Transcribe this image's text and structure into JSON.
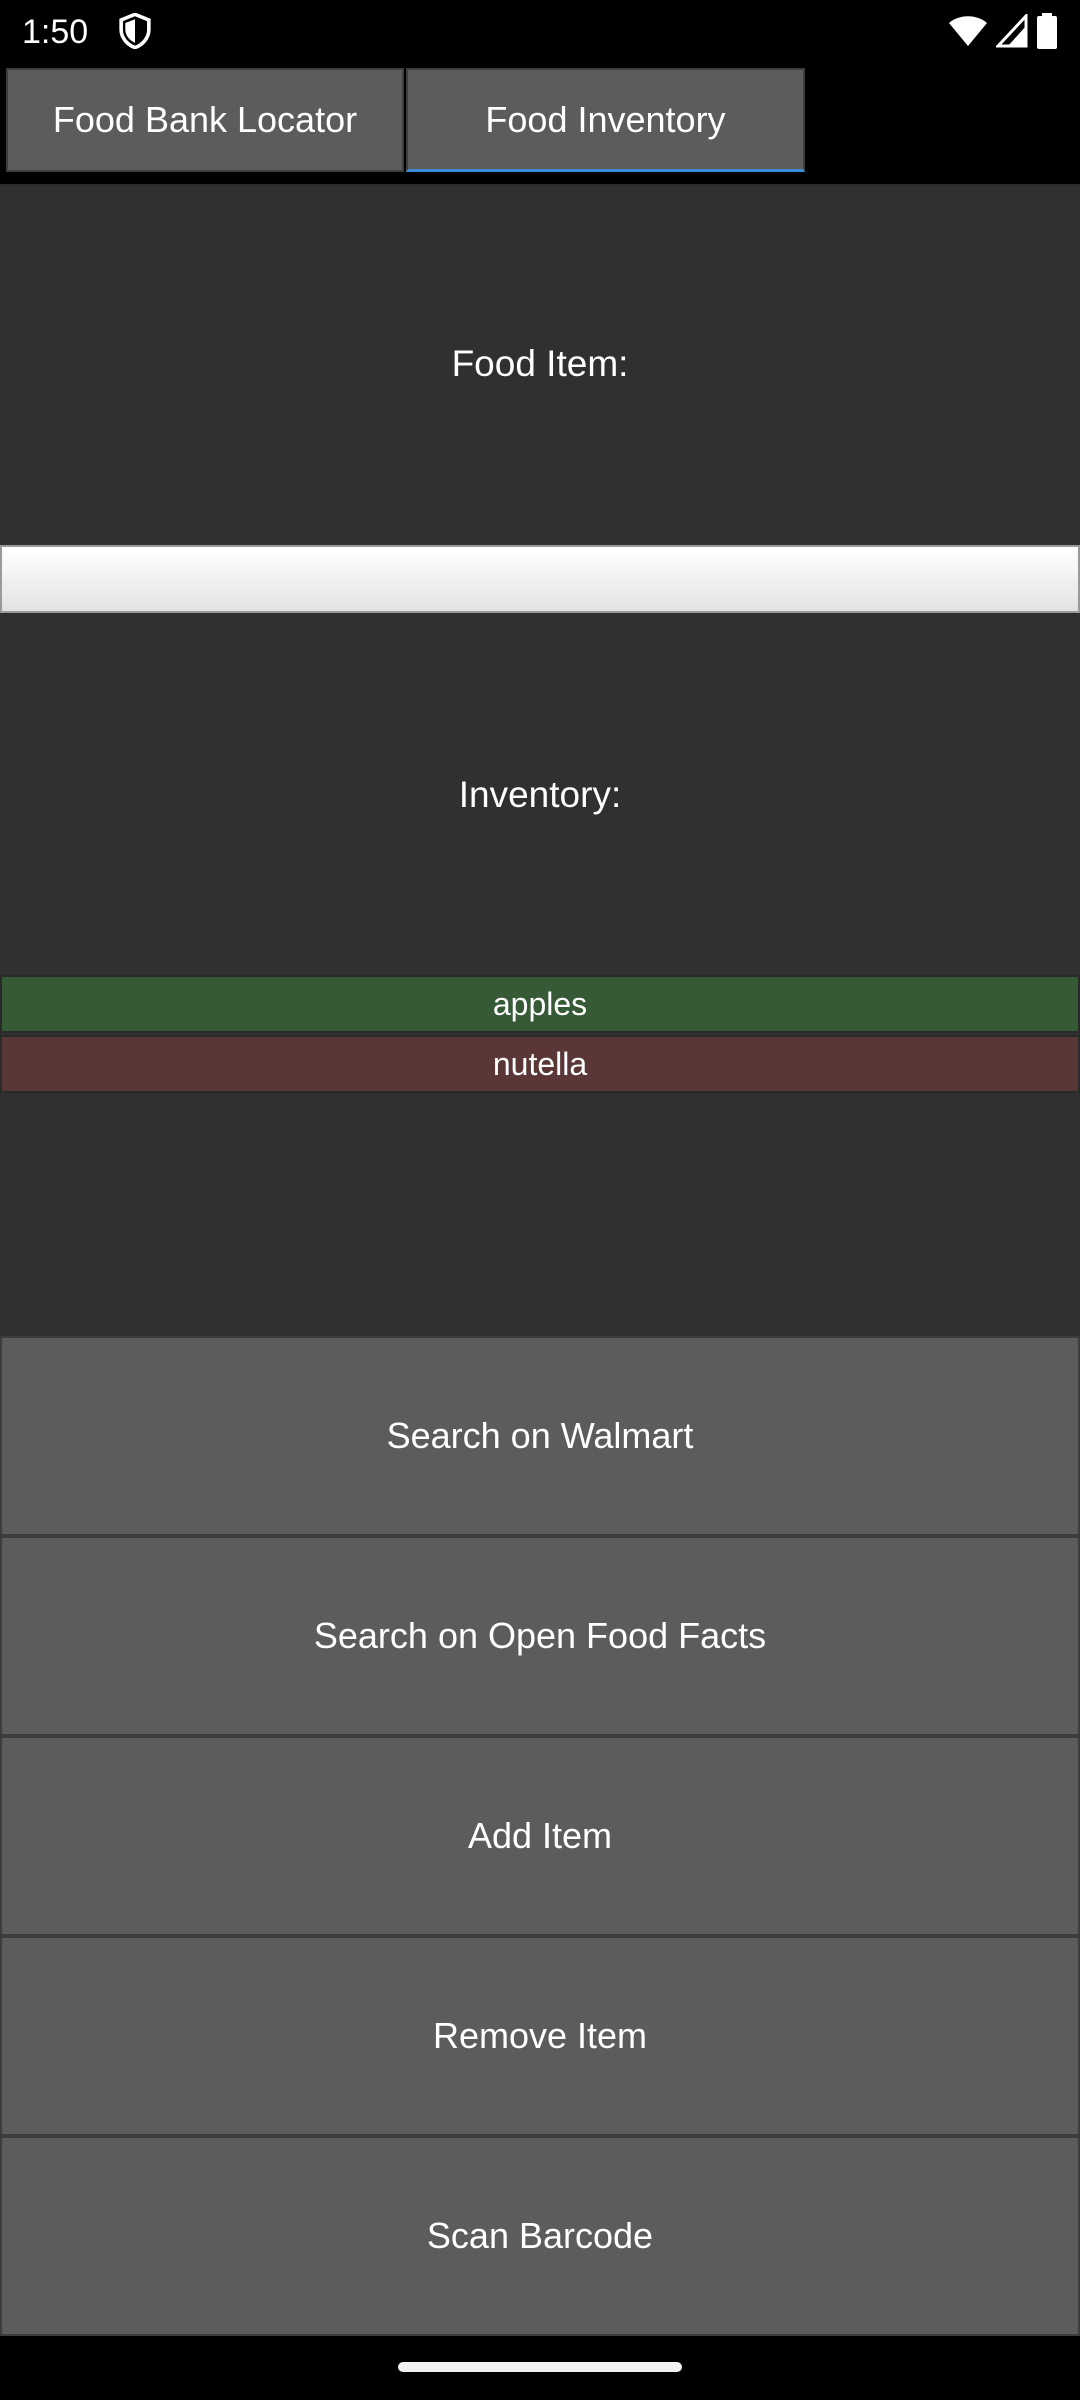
{
  "status_bar": {
    "time": "1:50",
    "icons": [
      "shield-icon",
      "wifi-icon",
      "signal-icon",
      "battery-icon"
    ]
  },
  "tabs": [
    {
      "label": "Food Bank Locator",
      "selected": false
    },
    {
      "label": "Food Inventory",
      "selected": true
    }
  ],
  "food_item": {
    "label": "Food Item:",
    "value": "",
    "placeholder": ""
  },
  "inventory": {
    "label": "Inventory:",
    "items": [
      {
        "name": "apples",
        "color": "#365a36"
      },
      {
        "name": "nutella",
        "color": "#5a3636"
      }
    ]
  },
  "actions": {
    "search_walmart": "Search on Walmart",
    "search_off": "Search on Open Food Facts",
    "add_item": "Add Item",
    "remove_item": "Remove Item",
    "scan_barcode": "Scan Barcode"
  },
  "colors": {
    "tab_indicator": "#3b8fd6",
    "panel_background": "#303030",
    "button_background": "#5c5c5c"
  }
}
